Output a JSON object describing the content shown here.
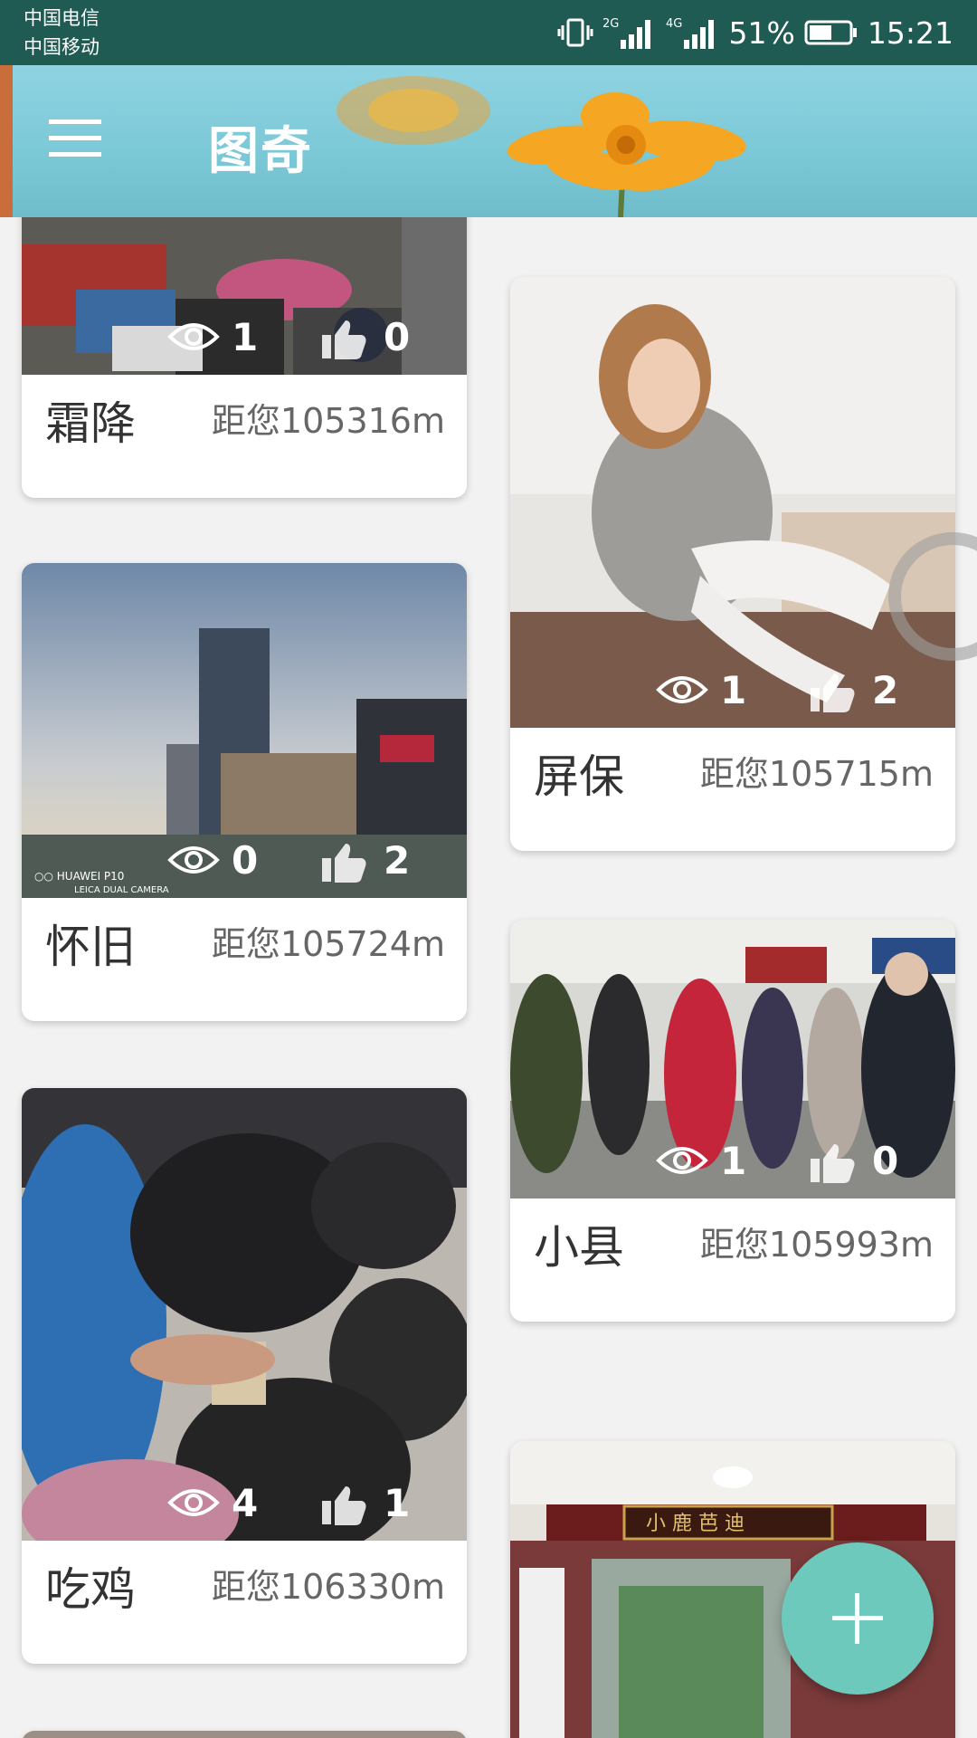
{
  "status_bar": {
    "carrier_1": "中国电信",
    "carrier_2": "中国移动",
    "net_1": "2G",
    "net_2": "4G",
    "battery": "51%",
    "time": "15:21",
    "icons": [
      "vibrate-icon",
      "signal-icon",
      "battery-icon"
    ]
  },
  "toolbar": {
    "title": "图奇",
    "menu_icon": "menu-icon"
  },
  "cards": [
    {
      "title": "霜降",
      "distance": "距您105316m",
      "views": "1",
      "likes": "0"
    },
    {
      "title": "屏保",
      "distance": "距您105715m",
      "views": "1",
      "likes": "2"
    },
    {
      "title": "怀旧",
      "distance": "距您105724m",
      "views": "0",
      "likes": "2"
    },
    {
      "title": "小县",
      "distance": "距您105993m",
      "views": "1",
      "likes": "0"
    },
    {
      "title": "吃鸡",
      "distance": "距您106330m",
      "views": "4",
      "likes": "1"
    }
  ],
  "fab": {
    "icon": "plus-icon"
  },
  "colors": {
    "status_bar": "#1f5b52",
    "toolbar": "#7cc9d8",
    "fab": "#6ec9bd"
  }
}
